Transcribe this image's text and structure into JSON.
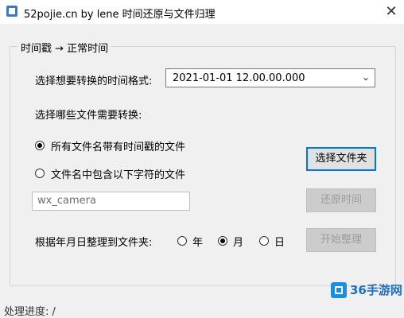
{
  "window": {
    "title": "52pojie.cn by lene 时间还原与文件归理",
    "close_glyph": "✕"
  },
  "group": {
    "legend": "时间戳 → 正常时间"
  },
  "format": {
    "label": "选择想要转换的时间格式:",
    "selected": "2021-01-01 12.00.00.000",
    "arrow": "⌄"
  },
  "files": {
    "label": "选择哪些文件需要转换:",
    "option_all": "所有文件名带有时间戳的文件",
    "option_contains": "文件名中包含以下字符的文件",
    "filter_value": "wx_camera"
  },
  "buttons": {
    "select_folder": "选择文件夹",
    "restore_time": "还原时间",
    "start_organize": "开始整理"
  },
  "organize": {
    "label": "根据年月日整理到文件夹:",
    "year": "年",
    "month": "月",
    "day": "日"
  },
  "status": {
    "progress": "处理进度: /"
  },
  "watermark": {
    "text": "36手游网"
  }
}
